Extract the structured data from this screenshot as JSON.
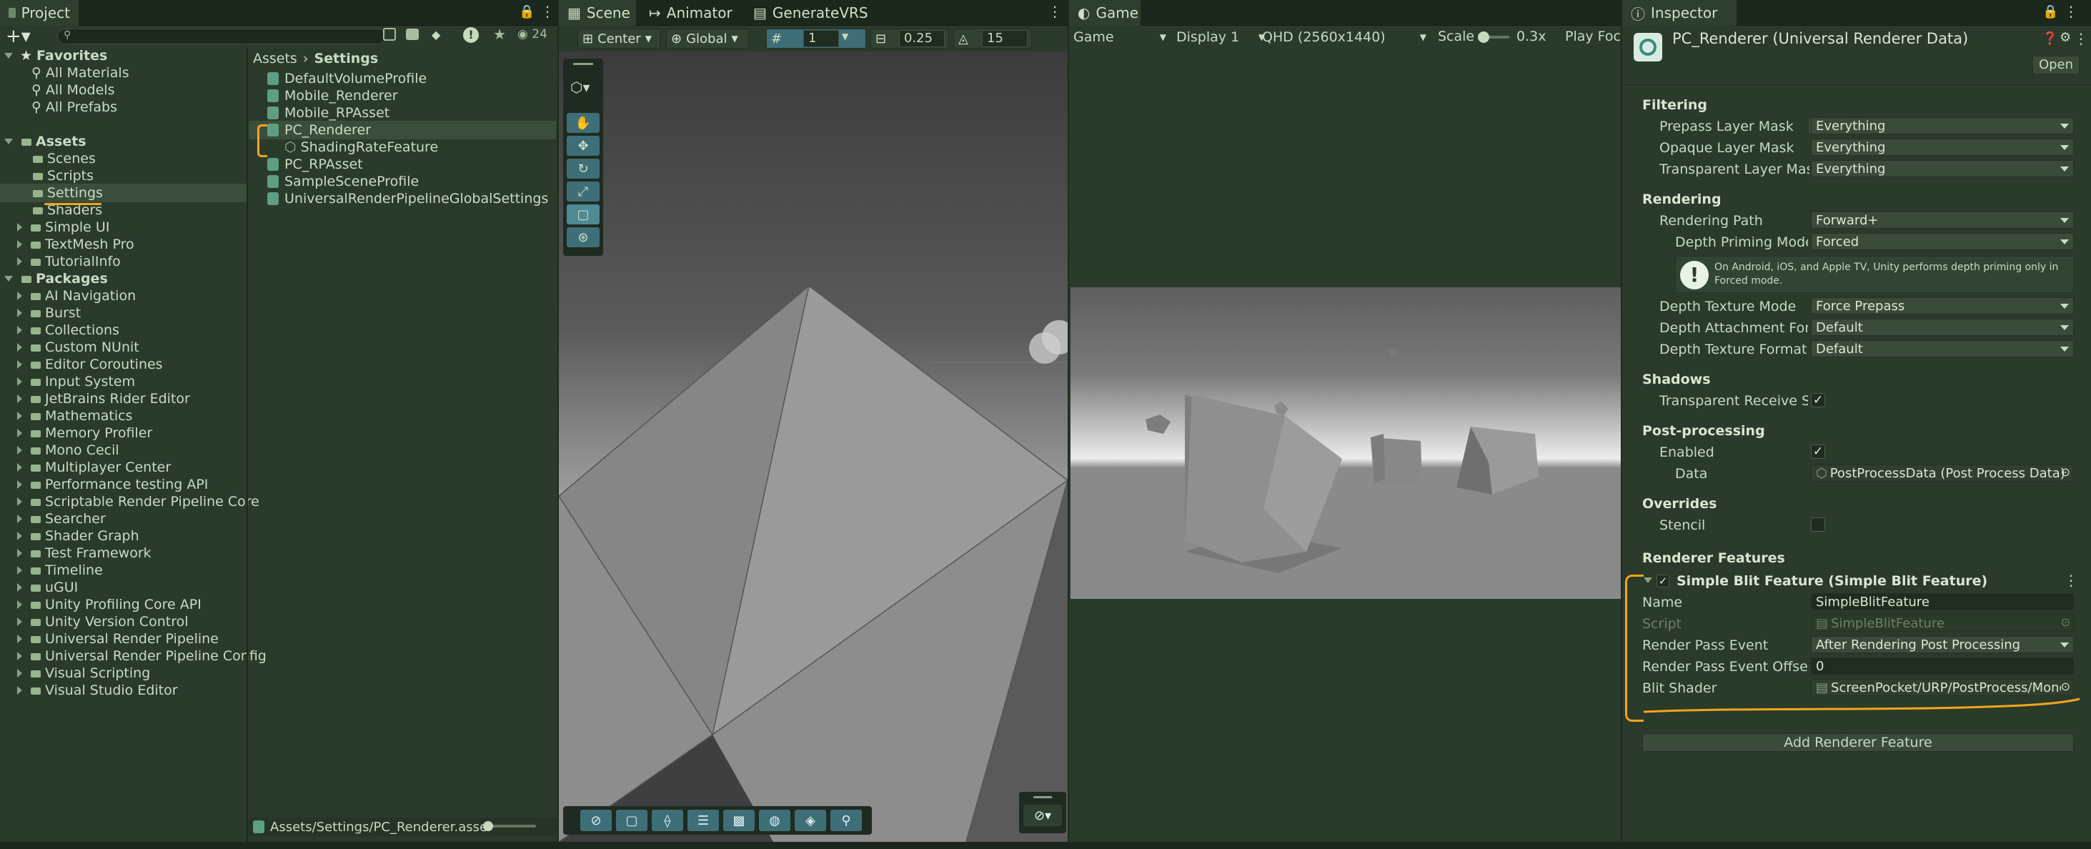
{
  "project": {
    "tab_label": "Project",
    "search_placeholder": "",
    "hidden_count": "24",
    "favorites_label": "Favorites",
    "favorites": [
      "All Materials",
      "All Models",
      "All Prefabs"
    ],
    "assets_label": "Assets",
    "assets_children": [
      "Scenes",
      "Scripts",
      "Settings",
      "Shaders",
      "Simple UI",
      "TextMesh Pro",
      "TutorialInfo"
    ],
    "packages_label": "Packages",
    "packages": [
      "AI Navigation",
      "Burst",
      "Collections",
      "Custom NUnit",
      "Editor Coroutines",
      "Input System",
      "JetBrains Rider Editor",
      "Mathematics",
      "Memory Profiler",
      "Mono Cecil",
      "Multiplayer Center",
      "Performance testing API",
      "Scriptable Render Pipeline Core",
      "Searcher",
      "Shader Graph",
      "Test Framework",
      "Timeline",
      "uGUI",
      "Unity Profiling Core API",
      "Unity Version Control",
      "Universal Render Pipeline",
      "Universal Render Pipeline Config",
      "Visual Scripting",
      "Visual Studio Editor"
    ],
    "breadcrumb_root": "Assets",
    "breadcrumb_current": "Settings",
    "files": [
      "DefaultVolumeProfile",
      "Mobile_Renderer",
      "Mobile_RPAsset",
      "PC_Renderer",
      "ShadingRateFeature",
      "PC_RPAsset",
      "SampleSceneProfile",
      "UniversalRenderPipelineGlobalSettings"
    ],
    "status_path": "Assets/Settings/PC_Renderer.asse"
  },
  "scene": {
    "tabs": [
      "Scene",
      "Animator",
      "GenerateVRS"
    ],
    "pivot": "Center",
    "space": "Global",
    "grid_value": "1",
    "snap_value": "0.25",
    "rotate_value": "15"
  },
  "game": {
    "tab_label": "Game",
    "mode": "Game",
    "display": "Display 1",
    "resolution": "QHD (2560x1440)",
    "scale_label": "Scale",
    "scale_value": "0.3x",
    "play_focus": "Play Focu"
  },
  "inspector": {
    "tab_label": "Inspector",
    "title": "PC_Renderer (Universal Renderer Data)",
    "open_label": "Open",
    "filtering": {
      "header": "Filtering",
      "prepass_label": "Prepass Layer Mask",
      "prepass_value": "Everything",
      "opaque_label": "Opaque Layer Mask",
      "opaque_value": "Everything",
      "transparent_label": "Transparent Layer Mask",
      "transparent_value": "Everything"
    },
    "rendering": {
      "header": "Rendering",
      "path_label": "Rendering Path",
      "path_value": "Forward+",
      "depth_priming_label": "Depth Priming Mode",
      "depth_priming_value": "Forced",
      "help_text": "On Android, iOS, and Apple TV, Unity performs depth priming only in Forced mode.",
      "depth_texture_mode_label": "Depth Texture Mode",
      "depth_texture_mode_value": "Force Prepass",
      "depth_attachment_label": "Depth Attachment Forma",
      "depth_attachment_value": "Default",
      "depth_texture_format_label": "Depth Texture Format",
      "depth_texture_format_value": "Default"
    },
    "shadows": {
      "header": "Shadows",
      "transparent_receive_label": "Transparent Receive Sha",
      "transparent_receive_checked": "✓"
    },
    "post": {
      "header": "Post-processing",
      "enabled_label": "Enabled",
      "enabled_checked": "✓",
      "data_label": "Data",
      "data_value": "PostProcessData (Post Process Data)"
    },
    "overrides": {
      "header": "Overrides",
      "stencil_label": "Stencil"
    },
    "features": {
      "header": "Renderer Features",
      "feature_title": "Simple Blit Feature (Simple Blit Feature)",
      "feature_checked": "✓",
      "name_label": "Name",
      "name_value": "SimpleBlitFeature",
      "script_label": "Script",
      "script_value": "SimpleBlitFeature",
      "event_label": "Render Pass Event",
      "event_value": "After Rendering Post Processing",
      "offset_label": "Render Pass Event Offset",
      "offset_value": "0",
      "shader_label": "Blit Shader",
      "shader_value": "ScreenPocket/URP/PostProcess/Mono",
      "add_label": "Add Renderer Feature"
    }
  },
  "colors": {
    "accent": "#3e6f78",
    "highlight": "#f2a51d",
    "panel": "#2a3a2b"
  }
}
